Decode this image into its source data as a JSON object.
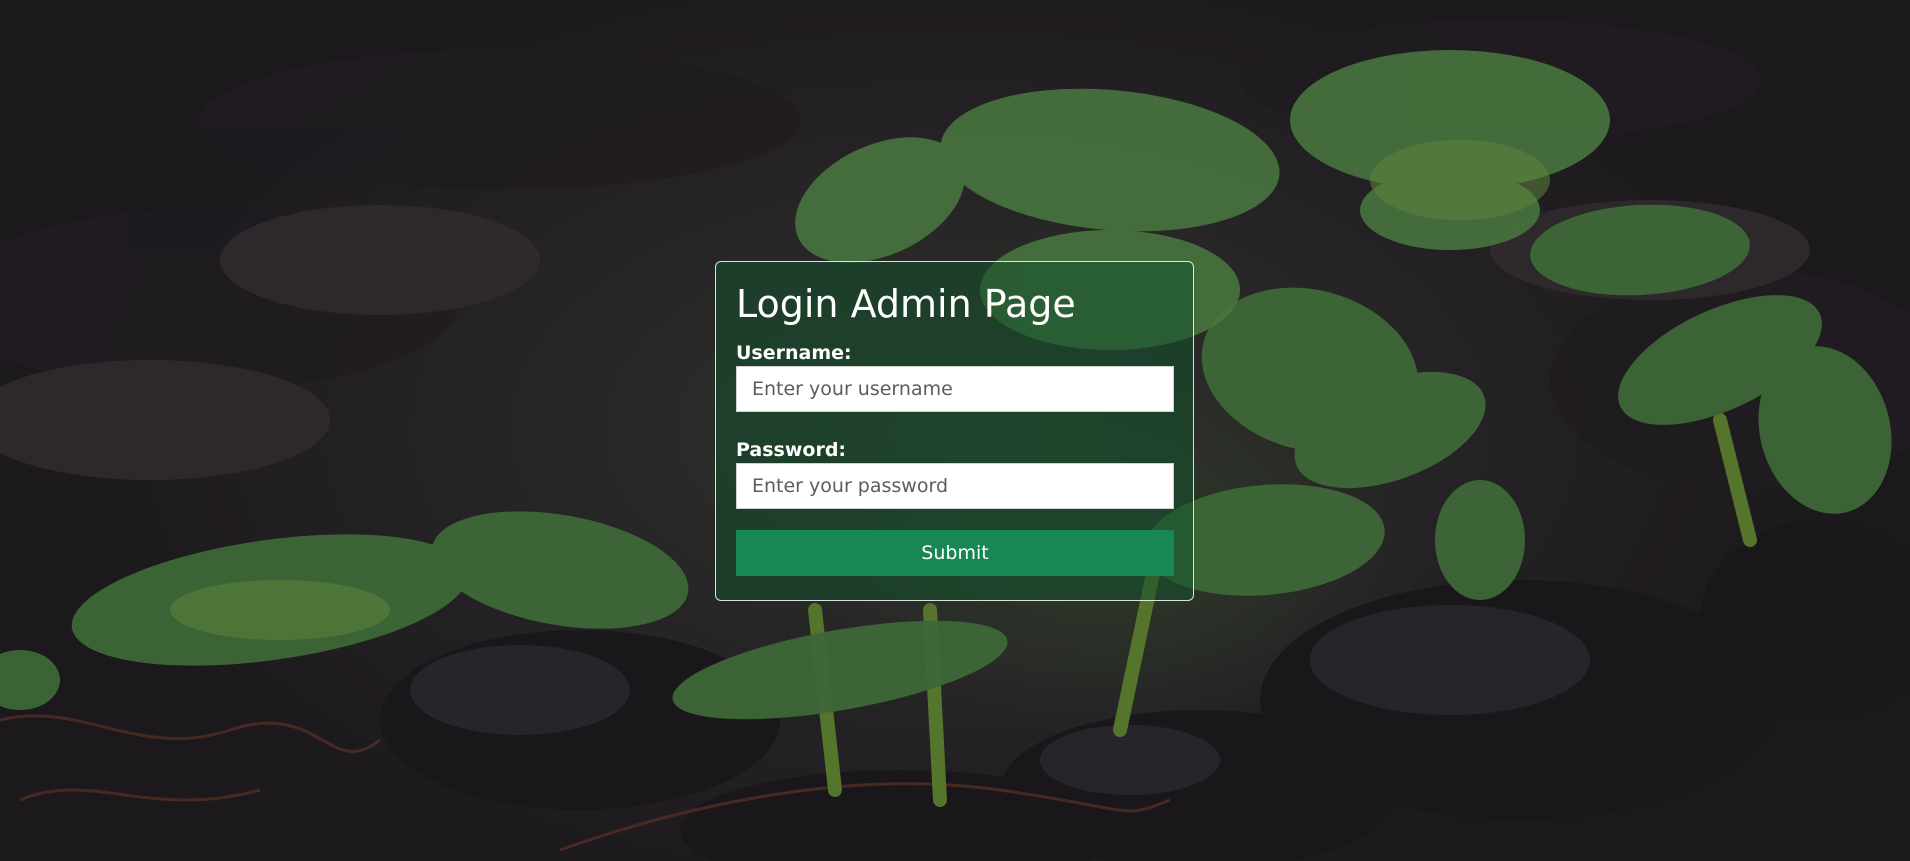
{
  "page": {
    "title": "Login Admin Page"
  },
  "form": {
    "username_label": "Username:",
    "username_placeholder": "Enter your username",
    "username_value": "",
    "password_label": "Password:",
    "password_placeholder": "Enter your password",
    "password_value": "",
    "submit_label": "Submit"
  },
  "colors": {
    "card_background": "#14502d",
    "submit_button": "#198754",
    "text": "#ffffff"
  },
  "background": {
    "subject": "green seedlings in dark soil"
  }
}
